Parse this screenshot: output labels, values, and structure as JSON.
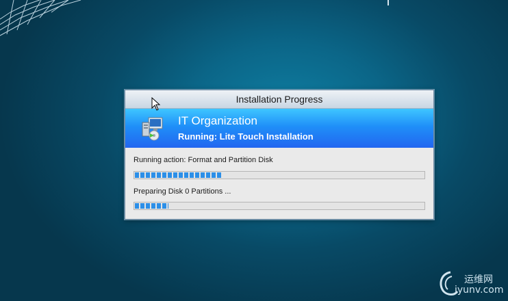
{
  "window": {
    "title": "Installation Progress"
  },
  "banner": {
    "icon": "computer-setup-icon",
    "title": "IT Organization",
    "subtitle": "Running: Lite Touch Installation"
  },
  "progress": {
    "action_label": "Running action: Format and Partition Disk",
    "action_fraction": 0.3,
    "step_label": "Preparing Disk 0 Partitions ...",
    "step_fraction": 0.115
  },
  "watermark": {
    "line1": "运维网",
    "line2": "iyunv.com"
  },
  "colors": {
    "banner_top": "#3fc6ff",
    "banner_bottom": "#2266f0",
    "progress_fill": "#2c8fe8",
    "window_bg": "#eaeaea"
  }
}
